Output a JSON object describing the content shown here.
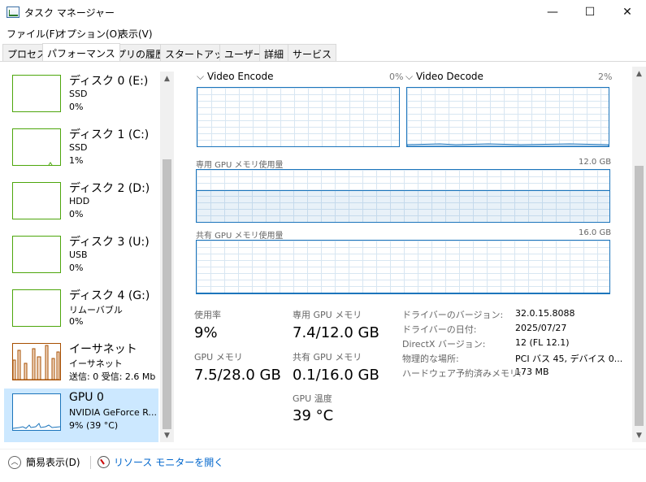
{
  "window": {
    "title": "タスク マネージャー",
    "minimize": "—",
    "maximize": "☐",
    "close": "✕"
  },
  "menu": [
    {
      "label": "ファイル(F)"
    },
    {
      "label": "オプション(O)"
    },
    {
      "label": "表示(V)"
    }
  ],
  "tabs": [
    {
      "label": "プロセス"
    },
    {
      "label": "パフォーマンス"
    },
    {
      "label": "アプリの履歴"
    },
    {
      "label": "スタートアップ"
    },
    {
      "label": "ユーザー"
    },
    {
      "label": "詳細"
    },
    {
      "label": "サービス"
    }
  ],
  "devices": [
    {
      "name": "ディスク 0 (E:)",
      "sub": "SSD",
      "value": "0%"
    },
    {
      "name": "ディスク 1 (C:)",
      "sub": "SSD",
      "value": "1%"
    },
    {
      "name": "ディスク 2 (D:)",
      "sub": "HDD",
      "value": "0%"
    },
    {
      "name": "ディスク 3 (U:)",
      "sub": "USB",
      "value": "0%"
    },
    {
      "name": "ディスク 4 (G:)",
      "sub": "リムーバブル",
      "value": "0%"
    },
    {
      "name": "イーサネット",
      "sub": "イーサネット",
      "value": "送信: 0 受信: 2.6 Mb"
    },
    {
      "name": "GPU 0",
      "sub": "NVIDIA GeForce R...",
      "value": "9% (39 °C)"
    }
  ],
  "gpu": {
    "encode": {
      "title": "Video Encode",
      "pct": "0%"
    },
    "decode": {
      "title": "Video Decode",
      "pct": "2%"
    },
    "dedicated_graph": {
      "label": "専用 GPU メモリ使用量",
      "max": "12.0 GB",
      "level": 0.617
    },
    "shared_graph": {
      "label": "共有 GPU メモリ使用量",
      "max": "16.0 GB",
      "level": 0.006
    },
    "stats": {
      "usage_label": "使用率",
      "usage_value": "9%",
      "gpu_mem_label": "GPU メモリ",
      "gpu_mem_value": "7.5/28.0 GB",
      "ded_label": "専用 GPU メモリ",
      "ded_value": "7.4/12.0 GB",
      "shared_label": "共有 GPU メモリ",
      "shared_value": "0.1/16.0 GB",
      "temp_label": "GPU 温度",
      "temp_value": "39 °C"
    },
    "info": [
      {
        "label": "ドライバーのバージョン:",
        "value": "32.0.15.8088"
      },
      {
        "label": "ドライバーの日付:",
        "value": "2025/07/27"
      },
      {
        "label": "DirectX バージョン:",
        "value": "12 (FL 12.1)"
      },
      {
        "label": "物理的な場所:",
        "value": "PCI バス 45, デバイス 0..."
      },
      {
        "label": "ハードウェア予約済みメモリ:",
        "value": "173 MB"
      }
    ]
  },
  "footer": {
    "fewer_details": "簡易表示(D)",
    "resource_monitor": "リソース モニターを開く"
  },
  "colors": {
    "disk": "#4da60c",
    "ethernet": "#a74f01",
    "gpu": "#1c75bc",
    "selected": "#cce8ff"
  }
}
